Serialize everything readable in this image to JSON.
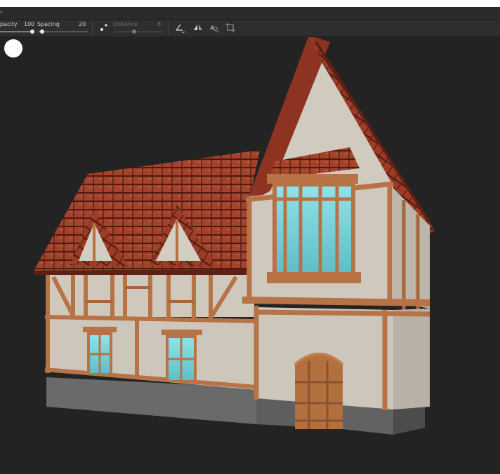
{
  "toolbar": {
    "opacity_label": "pacity",
    "opacity_value": "100",
    "spacing_label": "Spacing",
    "spacing_value": "20",
    "distance_label": "Distance",
    "distance_value": "8",
    "opacity_level": 1.0,
    "spacing_level": 0.2,
    "distance_level": 0.3,
    "icons": [
      "brush-dots-icon",
      "angle-icon",
      "mirror-icon",
      "symmetry-icon",
      "crop-icon"
    ]
  },
  "viewport": {
    "background": "#232323",
    "subject": "3d-house-model"
  },
  "colors": {
    "roof": "#9a3b27",
    "roof_dark": "#5e1f14",
    "plaster": "#cdc6ba",
    "timber": "#b77246",
    "glass": "#7fd3da",
    "stone": "#6e6e6e"
  }
}
